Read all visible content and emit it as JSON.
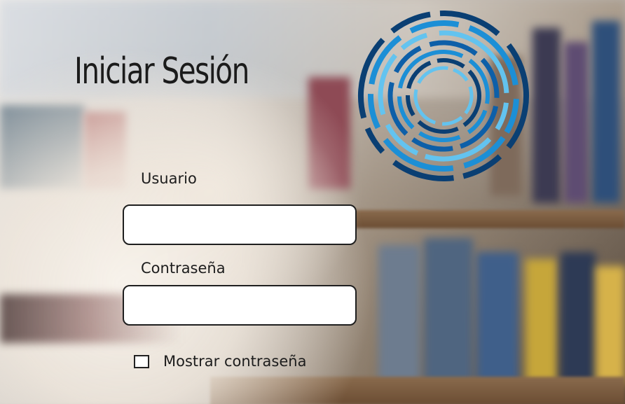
{
  "page": {
    "title": "Iniciar Sesión"
  },
  "form": {
    "username_label": "Usuario",
    "username_value": "",
    "password_label": "Contraseña",
    "password_value": "",
    "show_password_label": "Mostrar contraseña",
    "show_password_checked": false
  },
  "logo": {
    "icon": "concentric-rings-logo",
    "colors": [
      "#0d5fa8",
      "#1c8fd6",
      "#63c3ef",
      "#0a3f73"
    ]
  },
  "background": {
    "description_icon": "library-books-background"
  }
}
